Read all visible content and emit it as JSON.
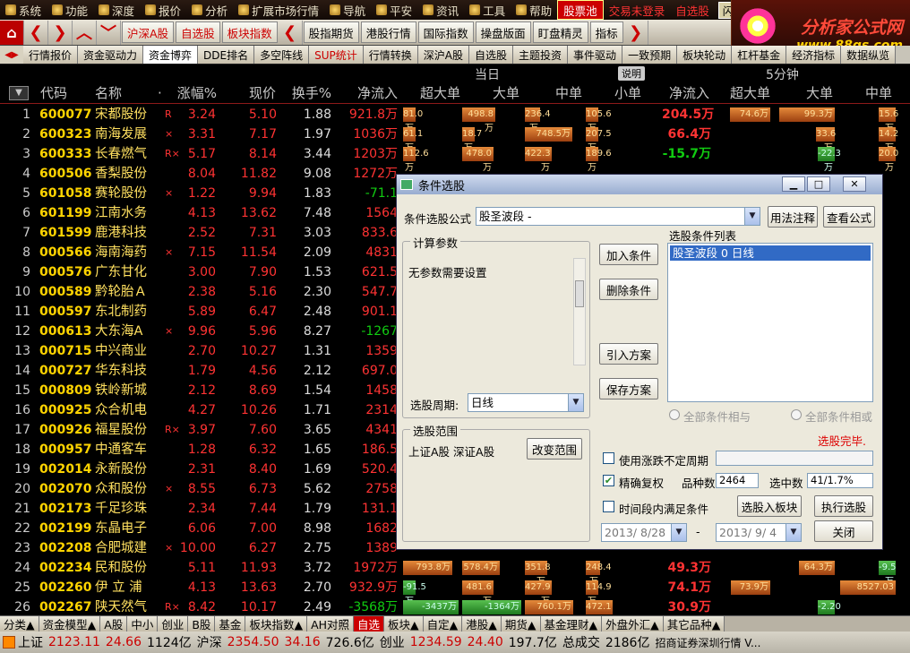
{
  "menubar": {
    "items": [
      "系统",
      "功能",
      "深度",
      "报价",
      "分析",
      "扩展市场行情",
      "导航",
      "平安",
      "资讯",
      "工具",
      "帮助"
    ],
    "active": "股票池",
    "red_items": [
      "交易未登录",
      "自选股"
    ],
    "box_items": [
      "闪电手",
      "信息"
    ]
  },
  "logo": {
    "line1": "分析家公式网",
    "line2": "www.88gs.com"
  },
  "toolbar": {
    "buttons": [
      "沪深A股",
      "自选股",
      "板块指数"
    ],
    "buttons2": [
      "股指期货",
      "港股行情",
      "国际指数",
      "操盘版面",
      "盯盘精灵",
      "指标"
    ]
  },
  "tabs": [
    "行情报价",
    "资金驱动力",
    "资金博弈",
    "DDE排名",
    "多空阵线",
    "SUP统计",
    "行情转换",
    "深沪A股",
    "自选股",
    "主题投资",
    "事件驱动",
    "一致预期",
    "板块轮动",
    "杠杆基金",
    "经济指标",
    "数据纵览"
  ],
  "tabs_selected": "资金博弈",
  "grid": {
    "group1": "当日",
    "group2": "5分钟",
    "explain": "说明",
    "headers": {
      "code": "代码",
      "name": "名称",
      "pct": "涨幅%",
      "price": "现价",
      "turnover": "换手%",
      "net": "净流入",
      "xl": "超大单",
      "l": "大单",
      "m": "中单",
      "s": "小单",
      "net5": "净流入",
      "xl5": "超大单",
      "l5": "大单",
      "m5": "中单"
    },
    "rows": [
      {
        "n": "1",
        "code": "600077",
        "name": "宋都股份",
        "flag": "R",
        "pct": "3.24",
        "price": "5.10",
        "turn": "1.88",
        "net": "921.8万",
        "b": [
          "81.0万",
          "498.8万",
          "236.4万",
          "105.6万"
        ],
        "net5": "204.5万",
        "b5": [
          "74.6万",
          "99.3万",
          "15.6万"
        ]
      },
      {
        "n": "2",
        "code": "600323",
        "name": "南海发展",
        "flag": "×",
        "pct": "3.31",
        "price": "7.17",
        "turn": "1.97",
        "net": "1036万",
        "b": [
          "61.1万",
          "18.7万",
          "748.5万",
          "207.5万"
        ],
        "net5": "66.4万",
        "b5": [
          "",
          "33.6万",
          "14.2万"
        ]
      },
      {
        "n": "3",
        "code": "600333",
        "name": "长春燃气",
        "flag": "R×",
        "pct": "5.17",
        "price": "8.14",
        "turn": "3.44",
        "net": "1203万",
        "b": [
          "112.6万",
          "478.0万",
          "422.3万",
          "189.6万"
        ],
        "net5": "-15.7万",
        "b5": [
          "",
          "-22.3万",
          "20.0万"
        ]
      },
      {
        "n": "4",
        "code": "600506",
        "name": "香梨股份",
        "flag": "",
        "pct": "8.04",
        "price": "11.82",
        "turn": "9.08",
        "net": "1272万",
        "b": [
          "",
          "",
          "",
          ""
        ],
        "net5": "",
        "b5": [
          "",
          "",
          ""
        ]
      },
      {
        "n": "5",
        "code": "601058",
        "name": "赛轮股份",
        "flag": "×",
        "pct": "1.22",
        "price": "9.94",
        "turn": "1.83",
        "net": "-71.1",
        "b": [
          "",
          "",
          "",
          ""
        ],
        "net5": "",
        "b5": [
          "",
          "",
          ""
        ]
      },
      {
        "n": "6",
        "code": "601199",
        "name": "江南水务",
        "flag": "",
        "pct": "4.13",
        "price": "13.62",
        "turn": "7.48",
        "net": "1564",
        "b": [
          "",
          "",
          "",
          ""
        ],
        "net5": "",
        "b5": [
          "",
          "",
          ""
        ]
      },
      {
        "n": "7",
        "code": "601599",
        "name": "鹿港科技",
        "flag": "",
        "pct": "2.52",
        "price": "7.31",
        "turn": "3.03",
        "net": "833.6",
        "b": [
          "",
          "",
          "",
          ""
        ],
        "net5": "",
        "b5": [
          "",
          "",
          ""
        ]
      },
      {
        "n": "8",
        "code": "000566",
        "name": "海南海药",
        "flag": "×",
        "pct": "7.15",
        "price": "11.54",
        "turn": "2.09",
        "net": "4831",
        "b": [
          "",
          "",
          "",
          ""
        ],
        "net5": "",
        "b5": [
          "",
          "",
          ""
        ]
      },
      {
        "n": "9",
        "code": "000576",
        "name": "广东甘化",
        "flag": "",
        "pct": "3.00",
        "price": "7.90",
        "turn": "1.53",
        "net": "621.5",
        "b": [
          "",
          "",
          "",
          ""
        ],
        "net5": "",
        "b5": [
          "",
          "",
          ""
        ]
      },
      {
        "n": "10",
        "code": "000589",
        "name": "黔轮胎Ａ",
        "flag": "",
        "pct": "2.38",
        "price": "5.16",
        "turn": "2.30",
        "net": "547.7",
        "b": [
          "",
          "",
          "",
          ""
        ],
        "net5": "",
        "b5": [
          "",
          "",
          ""
        ]
      },
      {
        "n": "11",
        "code": "000597",
        "name": "东北制药",
        "flag": "",
        "pct": "5.89",
        "price": "6.47",
        "turn": "2.48",
        "net": "901.1",
        "b": [
          "",
          "",
          "",
          ""
        ],
        "net5": "",
        "b5": [
          "",
          "",
          ""
        ]
      },
      {
        "n": "12",
        "code": "000613",
        "name": "大东海A",
        "flag": "×",
        "pct": "9.96",
        "price": "5.96",
        "turn": "8.27",
        "net": "-1267",
        "b": [
          "",
          "",
          "",
          ""
        ],
        "net5": "",
        "b5": [
          "",
          "",
          ""
        ]
      },
      {
        "n": "13",
        "code": "000715",
        "name": "中兴商业",
        "flag": "",
        "pct": "2.70",
        "price": "10.27",
        "turn": "1.31",
        "net": "1359",
        "b": [
          "",
          "",
          "",
          ""
        ],
        "net5": "",
        "b5": [
          "",
          "",
          ""
        ]
      },
      {
        "n": "14",
        "code": "000727",
        "name": "华东科技",
        "flag": "",
        "pct": "1.79",
        "price": "4.56",
        "turn": "2.12",
        "net": "697.0",
        "b": [
          "",
          "",
          "",
          ""
        ],
        "net5": "",
        "b5": [
          "",
          "",
          ""
        ]
      },
      {
        "n": "15",
        "code": "000809",
        "name": "铁岭新城",
        "flag": "",
        "pct": "2.12",
        "price": "8.69",
        "turn": "1.54",
        "net": "1458",
        "b": [
          "",
          "",
          "",
          ""
        ],
        "net5": "",
        "b5": [
          "",
          "",
          ""
        ]
      },
      {
        "n": "16",
        "code": "000925",
        "name": "众合机电",
        "flag": "",
        "pct": "4.27",
        "price": "10.26",
        "turn": "1.71",
        "net": "2314",
        "b": [
          "",
          "",
          "",
          ""
        ],
        "net5": "",
        "b5": [
          "",
          "",
          ""
        ]
      },
      {
        "n": "17",
        "code": "000926",
        "name": "福星股份",
        "flag": "R×",
        "pct": "3.97",
        "price": "7.60",
        "turn": "3.65",
        "net": "4341",
        "b": [
          "",
          "",
          "",
          ""
        ],
        "net5": "",
        "b5": [
          "",
          "",
          ""
        ]
      },
      {
        "n": "18",
        "code": "000957",
        "name": "中通客车",
        "flag": "",
        "pct": "1.28",
        "price": "6.32",
        "turn": "1.65",
        "net": "186.5",
        "b": [
          "",
          "",
          "",
          ""
        ],
        "net5": "",
        "b5": [
          "",
          "",
          ""
        ]
      },
      {
        "n": "19",
        "code": "002014",
        "name": "永新股份",
        "flag": "",
        "pct": "2.31",
        "price": "8.40",
        "turn": "1.69",
        "net": "520.4",
        "b": [
          "",
          "",
          "",
          ""
        ],
        "net5": "",
        "b5": [
          "",
          "",
          ""
        ]
      },
      {
        "n": "20",
        "code": "002070",
        "name": "众和股份",
        "flag": "×",
        "pct": "8.55",
        "price": "6.73",
        "turn": "5.62",
        "net": "2758",
        "b": [
          "",
          "",
          "",
          ""
        ],
        "net5": "",
        "b5": [
          "",
          "",
          ""
        ]
      },
      {
        "n": "21",
        "code": "002173",
        "name": "千足珍珠",
        "flag": "",
        "pct": "2.34",
        "price": "7.44",
        "turn": "1.79",
        "net": "131.1",
        "b": [
          "",
          "",
          "",
          ""
        ],
        "net5": "",
        "b5": [
          "",
          "",
          ""
        ]
      },
      {
        "n": "22",
        "code": "002199",
        "name": "东晶电子",
        "flag": "",
        "pct": "6.06",
        "price": "7.00",
        "turn": "8.98",
        "net": "1682",
        "b": [
          "",
          "",
          "",
          ""
        ],
        "net5": "",
        "b5": [
          "",
          "",
          ""
        ]
      },
      {
        "n": "23",
        "code": "002208",
        "name": "合肥城建",
        "flag": "×",
        "pct": "10.00",
        "price": "6.27",
        "turn": "2.75",
        "net": "1389",
        "b": [
          "",
          "",
          "",
          ""
        ],
        "net5": "",
        "b5": [
          "",
          "",
          ""
        ]
      },
      {
        "n": "24",
        "code": "002234",
        "name": "民和股份",
        "flag": "",
        "pct": "5.11",
        "price": "11.93",
        "turn": "3.72",
        "net": "1972万",
        "b": [
          "793.8万",
          "578.4万",
          "351.8万",
          "248.4万"
        ],
        "net5": "49.3万",
        "b5": [
          "",
          "64.3万",
          "-9.5万"
        ]
      },
      {
        "n": "25",
        "code": "002260",
        "name": "伊 立 浦",
        "flag": "",
        "pct": "4.13",
        "price": "13.63",
        "turn": "2.70",
        "net": "932.9万",
        "b": [
          "-91.5万",
          "481.6万",
          "427.9万",
          "114.9万"
        ],
        "net5": "74.1万",
        "b5": [
          "73.9万",
          "",
          "8527.03"
        ]
      },
      {
        "n": "26",
        "code": "002267",
        "name": "陕天然气",
        "flag": "R×",
        "pct": "8.42",
        "price": "10.17",
        "turn": "2.49",
        "net": "-3568万",
        "b": [
          "-3437万",
          "-1364万",
          "760.1万",
          "472.1万"
        ],
        "net5": "30.9万",
        "b5": [
          "",
          "-2.20",
          ""
        ]
      }
    ]
  },
  "bottom_tabs": [
    "分类▲",
    "资金模型▲",
    "A股",
    "中小",
    "创业",
    "B股",
    "基金",
    "板块指数▲",
    "AH对照",
    "自选",
    "板块▲",
    "自定▲",
    "港股▲",
    "期货▲",
    "基金理财▲",
    "外盘外汇▲",
    "其它品种▲"
  ],
  "bottom_selected": "自选",
  "status": {
    "sh_label": "上证",
    "sh_val": "2123.11",
    "sh_chg": "24.66",
    "sh_amt": "1124亿",
    "hs_label": "沪深",
    "hs_val": "2354.50",
    "hs_chg": "34.16",
    "hs_amt": "726.6亿",
    "cy_label": "创业",
    "cy_val": "1234.59",
    "cy_chg": "24.40",
    "cy_amt": "197.7亿",
    "total_label": "总成交",
    "total_amt": "2186亿",
    "broker": "招商证券深圳行情 V..."
  },
  "dialog": {
    "title": "条件选股",
    "formula_label": "条件选股公式",
    "formula_value": "股圣波段 -",
    "usage_btn": "用法注释",
    "view_btn": "查看公式",
    "params_group": "计算参数",
    "params_text": "无参数需要设置",
    "period_label": "选股周期:",
    "period_value": "日线",
    "range_group": "选股范围",
    "range_value": "上证A股 深证A股",
    "change_range_btn": "改变范围",
    "add_btn": "加入条件",
    "delete_btn": "删除条件",
    "import_btn": "引入方案",
    "save_btn": "保存方案",
    "list_label": "选股条件列表",
    "list_items": [
      "股圣波段 0 日线"
    ],
    "and_label": "全部条件相与",
    "or_label": "全部条件相或",
    "done_text": "选股完毕.",
    "use_range_label": "使用涨跌不定周期",
    "exact_label": "精确复权",
    "count_label": "品种数",
    "count_value": "2464",
    "hit_label": "选中数",
    "hit_value": "41/1.7%",
    "period_range_label": "时间段内满足条件",
    "to_block_btn": "选股入板块",
    "run_btn": "执行选股",
    "date_from": "2013/ 8/28",
    "date_sep": "-",
    "date_to": "2013/ 9/ 4",
    "close_btn": "关闭"
  }
}
